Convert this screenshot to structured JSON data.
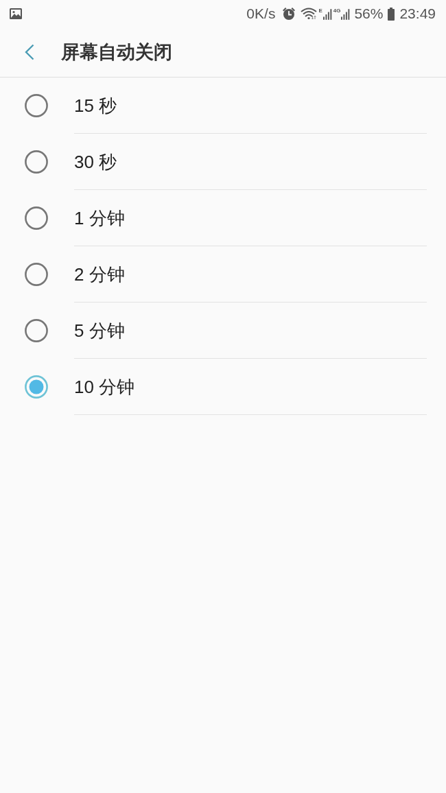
{
  "status_bar": {
    "speed": "0K/s",
    "network_labels": [
      "E",
      "4G"
    ],
    "battery": "56%",
    "time": "23:49"
  },
  "header": {
    "title": "屏幕自动关闭"
  },
  "options": [
    {
      "label": "15 秒",
      "selected": false
    },
    {
      "label": "30 秒",
      "selected": false
    },
    {
      "label": "1 分钟",
      "selected": false
    },
    {
      "label": "2 分钟",
      "selected": false
    },
    {
      "label": "5 分钟",
      "selected": false
    },
    {
      "label": "10 分钟",
      "selected": true
    }
  ]
}
